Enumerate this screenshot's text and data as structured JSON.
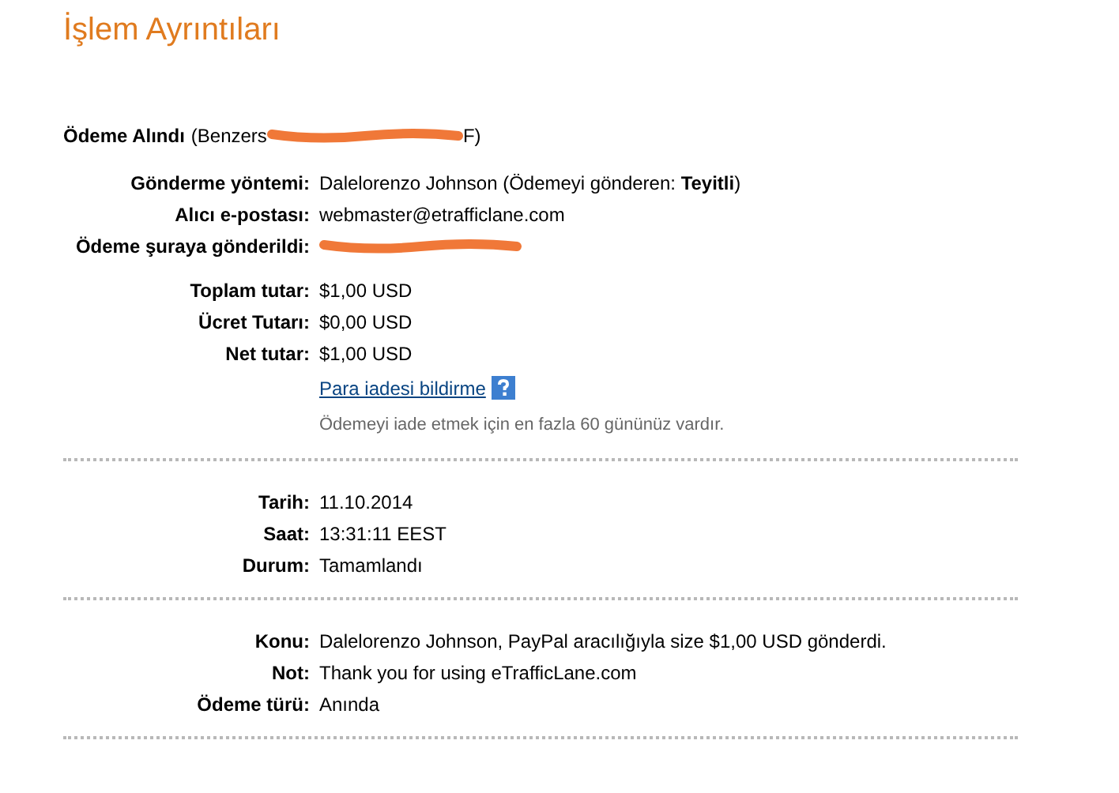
{
  "title": "İşlem Ayrıntıları",
  "sections": [
    {
      "heading": {
        "label": "Ödeme Alındı",
        "detail_start": "(Benzers",
        "detail_end": "F)"
      },
      "groups": [
        [
          {
            "kind": "field",
            "label": "Gönderme yöntemi:",
            "value": "Dalelorenzo Johnson (Ödemeyi gönderen: **Teyitli**)"
          },
          {
            "kind": "field",
            "label": "Alıcı e-postası:",
            "value": "webmaster@etrafficlane.com"
          },
          {
            "kind": "redacted",
            "label": "Ödeme şuraya gönderildi:"
          }
        ],
        [
          {
            "kind": "field",
            "label": "Toplam tutar:",
            "value": "$1,00 USD"
          },
          {
            "kind": "field",
            "label": "Ücret Tutarı:",
            "value": "$0,00 USD"
          },
          {
            "kind": "field",
            "label": "Net tutar:",
            "value": "$1,00 USD"
          },
          {
            "kind": "link",
            "value": "Para iadesi bildirme"
          },
          {
            "kind": "note",
            "value": "Ödemeyi iade etmek için en fazla 60 gününüz vardır."
          }
        ]
      ]
    },
    {
      "groups": [
        [
          {
            "kind": "field",
            "label": "Tarih:",
            "value": "11.10.2014"
          },
          {
            "kind": "field",
            "label": "Saat:",
            "value": "13:31:11 EEST"
          },
          {
            "kind": "field",
            "label": "Durum:",
            "value": "Tamamlandı"
          }
        ]
      ]
    },
    {
      "groups": [
        [
          {
            "kind": "field",
            "label": "Konu:",
            "value": "Dalelorenzo Johnson, PayPal aracılığıyla size $1,00 USD gönderdi."
          },
          {
            "kind": "field",
            "label": "Not:",
            "value": "Thank you for using eTrafficLane.com"
          },
          {
            "kind": "field",
            "label": "Ödeme türü:",
            "value": "Anında"
          }
        ]
      ]
    }
  ]
}
